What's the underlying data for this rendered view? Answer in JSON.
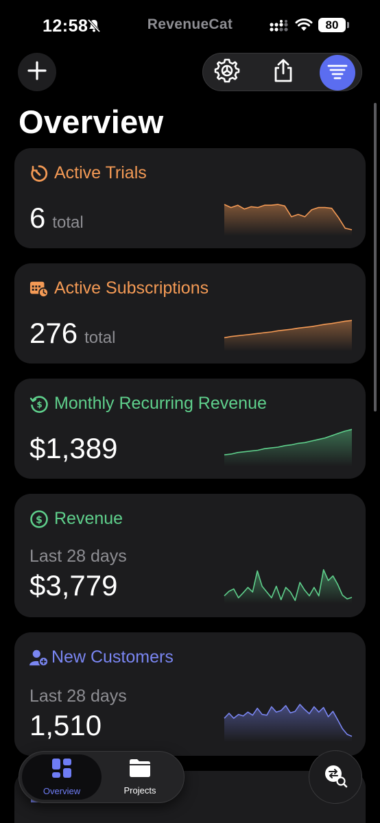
{
  "status_bar": {
    "time": "12:58",
    "brand": "RevenueCat",
    "battery": "80"
  },
  "page": {
    "title": "Overview"
  },
  "icons": {
    "add": "plus-icon",
    "settings": "gear-icon",
    "share": "share-icon",
    "filter": "filter-lines-icon"
  },
  "colors": {
    "orange": "#f49a55",
    "green": "#5fd08c",
    "blue": "#7a86f2",
    "accent": "#5b6df0",
    "card_bg": "#1c1c1e"
  },
  "cards": {
    "active_trials": {
      "title": "Active Trials",
      "value": "6",
      "unit": "total",
      "trend": [
        0.82,
        0.74,
        0.8,
        0.7,
        0.76,
        0.74,
        0.8,
        0.8,
        0.82,
        0.78,
        0.5,
        0.56,
        0.5,
        0.68,
        0.74,
        0.74,
        0.72,
        0.48,
        0.2,
        0.16
      ]
    },
    "active_subscriptions": {
      "title": "Active Subscriptions",
      "value": "276",
      "unit": "total",
      "trend": [
        0.35,
        0.38,
        0.4,
        0.42,
        0.44,
        0.46,
        0.48,
        0.5,
        0.53,
        0.55,
        0.57,
        0.6,
        0.62,
        0.64,
        0.67,
        0.7,
        0.72,
        0.75,
        0.78,
        0.8
      ]
    },
    "mrr": {
      "title": "Monthly Recurring Revenue",
      "value": "$1,389",
      "trend": [
        0.3,
        0.32,
        0.36,
        0.38,
        0.4,
        0.42,
        0.46,
        0.48,
        0.5,
        0.54,
        0.56,
        0.6,
        0.62,
        0.66,
        0.7,
        0.74,
        0.8,
        0.86,
        0.92,
        0.96
      ]
    },
    "revenue": {
      "title": "Revenue",
      "period": "Last 28 days",
      "value": "$3,779",
      "trend": [
        0.2,
        0.32,
        0.38,
        0.15,
        0.28,
        0.42,
        0.3,
        0.85,
        0.45,
        0.3,
        0.15,
        0.45,
        0.1,
        0.42,
        0.3,
        0.08,
        0.55,
        0.35,
        0.2,
        0.42,
        0.2,
        0.88,
        0.6,
        0.72,
        0.5,
        0.22,
        0.12,
        0.16
      ]
    },
    "new_customers": {
      "title": "New Customers",
      "period": "Last 28 days",
      "value": "1,510",
      "trend": [
        0.62,
        0.75,
        0.62,
        0.72,
        0.68,
        0.78,
        0.7,
        0.88,
        0.72,
        0.7,
        0.92,
        0.78,
        0.82,
        0.95,
        0.76,
        0.8,
        0.98,
        0.85,
        0.74,
        0.92,
        0.78,
        0.9,
        0.66,
        0.8,
        0.58,
        0.35,
        0.2,
        0.15
      ]
    }
  },
  "tabs": [
    {
      "label": "Overview",
      "icon": "dashboard-icon",
      "active": true
    },
    {
      "label": "Projects",
      "icon": "folder-icon",
      "active": false
    }
  ]
}
